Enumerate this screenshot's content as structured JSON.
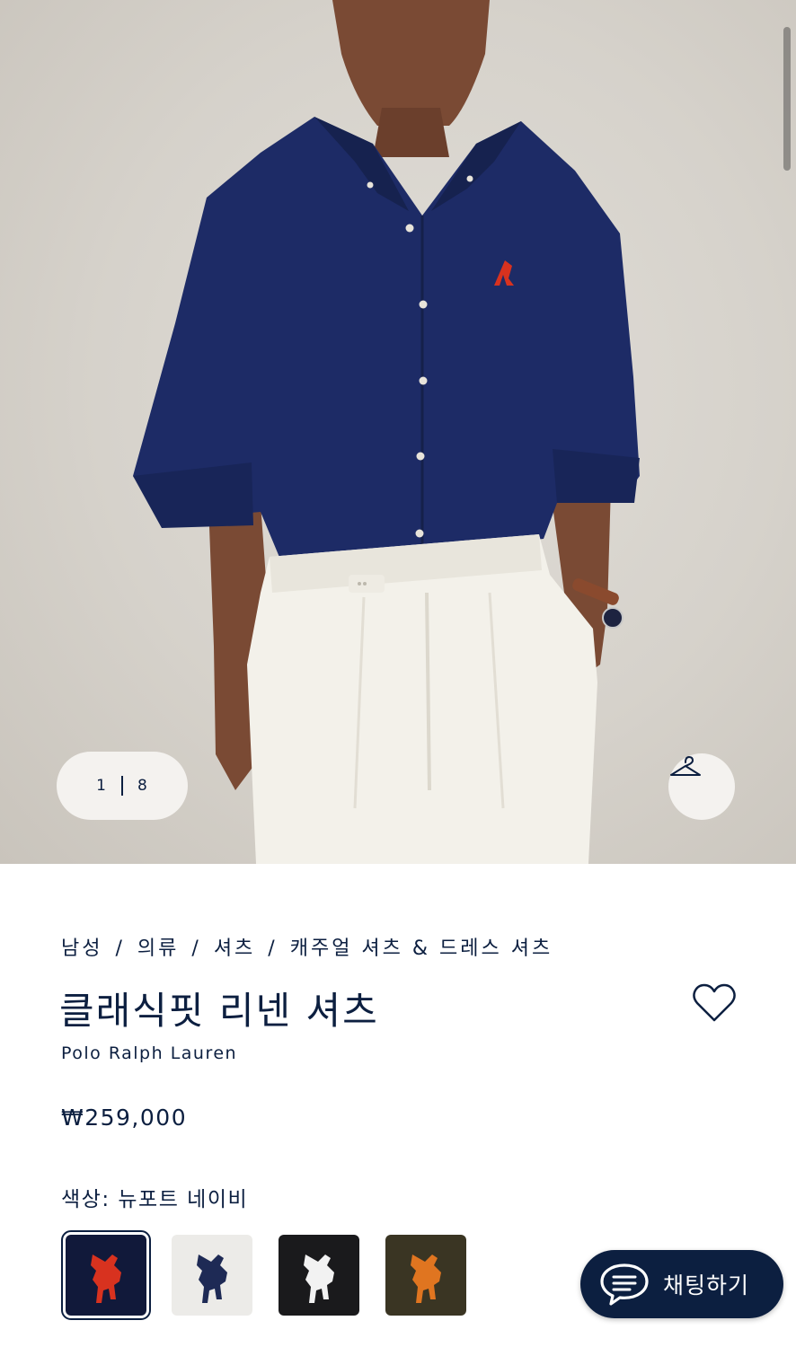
{
  "gallery": {
    "current_index": "1",
    "total": "8",
    "hanger_icon": "hanger-icon"
  },
  "breadcrumb": [
    "남성",
    "의류",
    "셔츠",
    "캐주얼 셔츠 & 드레스 셔츠"
  ],
  "product": {
    "title": "클래식핏 리넨 셔츠",
    "brand": "Polo Ralph Lauren",
    "price": "₩259,000",
    "color_label": "색상: 뉴포트 네이비"
  },
  "swatches": [
    {
      "name": "뉴포트 네이비",
      "bg": "#11193a",
      "logo": "#d8321f",
      "selected": true
    },
    {
      "name": "화이트",
      "bg": "#ecebe8",
      "logo": "#1e2a55",
      "selected": false
    },
    {
      "name": "블랙",
      "bg": "#1a1a1c",
      "logo": "#f2f2f2",
      "selected": false
    },
    {
      "name": "올리브",
      "bg": "#3a3523",
      "logo": "#e07520",
      "selected": false
    }
  ],
  "chat": {
    "label": "채팅하기"
  },
  "colors": {
    "brand_navy": "#0c1f40",
    "shirt_navy": "#1d2b66",
    "background": "#ffffff"
  }
}
